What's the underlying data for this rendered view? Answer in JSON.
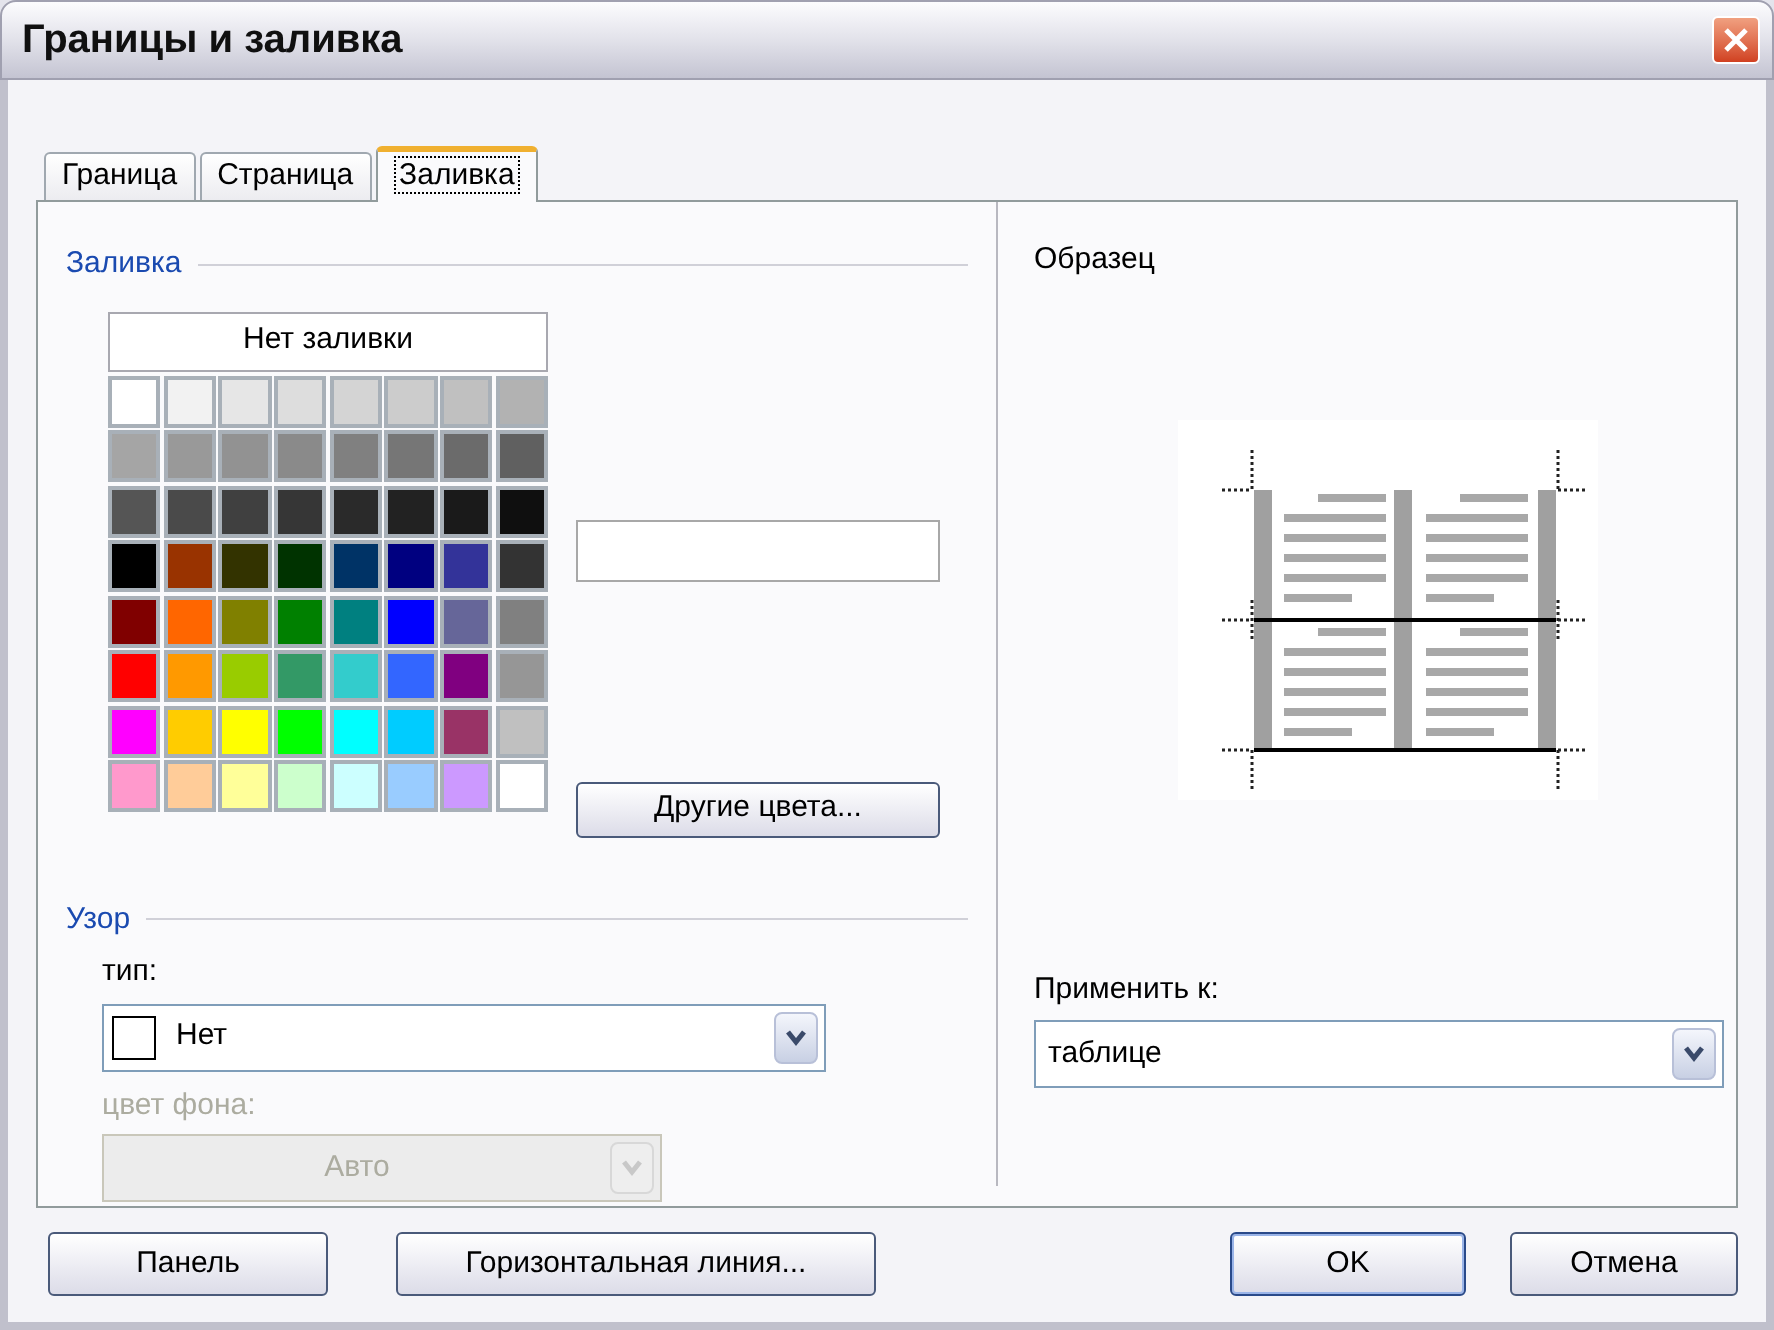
{
  "window": {
    "title": "Границы и заливка"
  },
  "tabs": [
    {
      "label": "Граница",
      "selected": false
    },
    {
      "label": "Страница",
      "selected": false
    },
    {
      "label": "Заливка",
      "selected": true
    }
  ],
  "fill": {
    "heading": "Заливка",
    "no_fill": "Нет заливки",
    "more_colors": "Другие цвета...",
    "swatches": [
      {
        "color": "#ffffff"
      },
      {
        "color": "#f2f2f2"
      },
      {
        "color": "#e6e6e6"
      },
      {
        "color": "#dddddd"
      },
      {
        "color": "#d4d4d4"
      },
      {
        "color": "#cccccc"
      },
      {
        "color": "#c0c0c0"
      },
      {
        "color": "#b2b2b2"
      },
      {
        "color": "#a5a5a5"
      },
      {
        "color": "#999999"
      },
      {
        "color": "#929292"
      },
      {
        "color": "#8a8a8a"
      },
      {
        "color": "#808080"
      },
      {
        "color": "#767676"
      },
      {
        "color": "#6b6b6b"
      },
      {
        "color": "#606060"
      },
      {
        "color": "#555555"
      },
      {
        "color": "#4a4a4a"
      },
      {
        "color": "#404040"
      },
      {
        "color": "#363636"
      },
      {
        "color": "#2a2a2a"
      },
      {
        "color": "#222222"
      },
      {
        "color": "#1a1a1a"
      },
      {
        "color": "#0f0f0f"
      },
      {
        "color": "#000000"
      },
      {
        "color": "#993300"
      },
      {
        "color": "#333300"
      },
      {
        "color": "#003300"
      },
      {
        "color": "#003366"
      },
      {
        "color": "#000080"
      },
      {
        "color": "#333399"
      },
      {
        "color": "#333333"
      },
      {
        "color": "#800000"
      },
      {
        "color": "#ff6600"
      },
      {
        "color": "#808000"
      },
      {
        "color": "#008000"
      },
      {
        "color": "#008080"
      },
      {
        "color": "#0000ff"
      },
      {
        "color": "#666699"
      },
      {
        "color": "#808080"
      },
      {
        "color": "#ff0000"
      },
      {
        "color": "#ff9900"
      },
      {
        "color": "#99cc00"
      },
      {
        "color": "#339966"
      },
      {
        "color": "#33cccc"
      },
      {
        "color": "#3366ff"
      },
      {
        "color": "#800080"
      },
      {
        "color": "#969696"
      },
      {
        "color": "#ff00ff"
      },
      {
        "color": "#ffcc00"
      },
      {
        "color": "#ffff00"
      },
      {
        "color": "#00ff00"
      },
      {
        "color": "#00ffff"
      },
      {
        "color": "#00ccff"
      },
      {
        "color": "#993366"
      },
      {
        "color": "#c0c0c0"
      },
      {
        "color": "#ff99cc"
      },
      {
        "color": "#ffcc99"
      },
      {
        "color": "#ffff99"
      },
      {
        "color": "#ccffcc"
      },
      {
        "color": "#ccffff"
      },
      {
        "color": "#99ccff"
      },
      {
        "color": "#cc99ff"
      },
      {
        "color": "#ffffff"
      }
    ]
  },
  "pattern": {
    "heading": "Узор",
    "type_label": "тип:",
    "type_value": "Нет",
    "background_label": "цвет фона:",
    "background_value": "Авто",
    "background_disabled": true
  },
  "sample": {
    "heading": "Образец",
    "apply_label": "Применить к:",
    "apply_value": "таблице"
  },
  "buttons": [
    {
      "label": "Панель",
      "kind": "left"
    },
    {
      "label": "Горизонтальная линия...",
      "kind": "left"
    },
    {
      "label": "OK",
      "kind": "default"
    },
    {
      "label": "Отмена",
      "kind": "right"
    }
  ]
}
